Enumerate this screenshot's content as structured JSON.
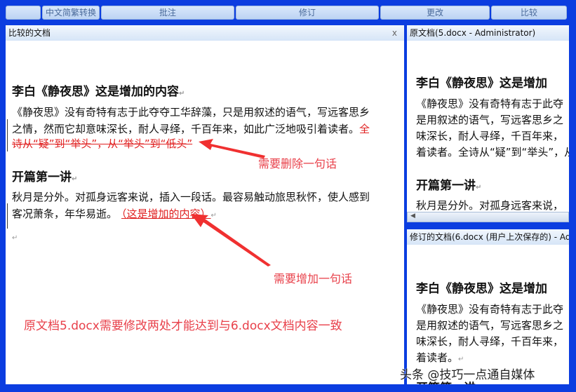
{
  "toolbar": {
    "groups": [
      "中文简繁转换",
      "批注",
      "修订",
      "更改",
      "比较"
    ]
  },
  "compared": {
    "title": "比较的文档",
    "close": "x",
    "heading": "李白《静夜思》这是增加的内容",
    "p1_line1": "《静夜思》没有奇特有志于此夺夺工华辞藻，只是用叙述的语气，写远客思乡",
    "p1_line2": "之情，然而它却意味深长，耐人寻绎，千百年来，如此广泛地吸引着读者。",
    "p1_deleted_a": "全",
    "p1_deleted_b": "诗从“疑”到“举头”，从“举头”到“低头”",
    "heading2": "开篇第一讲",
    "p2_line1": "秋月是分外。对孤身远客来说，插入一段话。最容易触动旅思秋怀，使人感到",
    "p2_line2": "客况萧条，年华易逝。",
    "p2_inserted": "（这是增加的内容）",
    "para_mark": "↵"
  },
  "annotations": {
    "delete": "需要删除一句话",
    "add": "需要增加一句话",
    "summary": "原文档5.docx需要修改两处才能达到与6.docx文档内容一致"
  },
  "original": {
    "title": "原文档(5.docx - Administrator)",
    "heading": "李白《静夜思》这是增加",
    "lines": [
      "《静夜思》没有奇特有志于此夺",
      "是用叙述的语气，写远客思乡之",
      "味深长，耐人寻绎，千百年来，",
      "着读者。全诗从“疑”到“举头”，从"
    ],
    "heading2": "开篇第一讲",
    "p2": "秋月是分外。对孤身远客来说，"
  },
  "revised": {
    "title": "修订的文档(6.docx (用户上次保存的) - Ad",
    "heading": "李白《静夜思》这是增加",
    "lines": [
      "《静夜思》没有奇特有志于此夺",
      "是用叙述的语气，写远客思乡之",
      "味深长，耐人寻绎，千百年来，",
      "着读者。"
    ],
    "heading2": "开篇第一讲"
  },
  "watermark": "头条 @技巧一点通自媒体"
}
